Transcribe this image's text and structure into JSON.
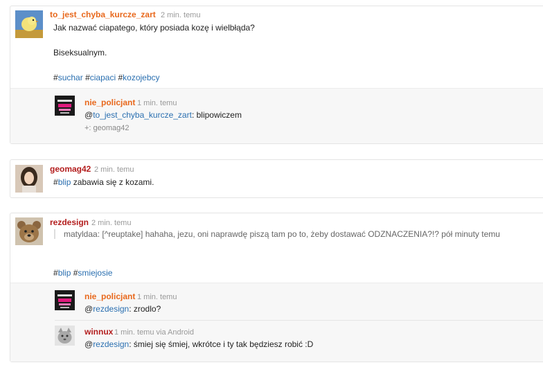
{
  "entries": [
    {
      "author": "to_jest_chyba_kurcze_zart",
      "time": "2 min. temu",
      "lines": [
        "Jak nazwać ciapatego, który posiada kozę i wielbłąda?",
        "Biseksualnym."
      ],
      "tags": [
        "suchar",
        "ciapaci",
        "kozojebcy"
      ],
      "comments": [
        {
          "author": "nie_policjant",
          "time": "1 min. temu",
          "mention": "to_jest_chyba_kurcze_zart",
          "text": ": blipowiczem",
          "plus": "+: geomag42"
        }
      ]
    },
    {
      "author": "geomag42",
      "time": "2 min. temu",
      "tag": "blip",
      "text": " zabawia się z kozami."
    },
    {
      "author": "rezdesign",
      "time": "2 min. temu",
      "quote": "matyldaa: [^reuptake] hahaha, jezu, oni naprawdę piszą tam po to, żeby dostawać ODZNACZENIA?!? pół minuty temu",
      "tags": [
        "blip",
        "smiejosie"
      ],
      "comments": [
        {
          "author": "nie_policjant",
          "time": "1 min. temu",
          "mention": "rezdesign",
          "text": ": zrodlo?"
        },
        {
          "author": "winnux",
          "time": "1 min. temu via Android",
          "mention": "rezdesign",
          "text": ": śmiej się śmiej, wkrótce i ty tak będziesz robić :D"
        }
      ]
    }
  ],
  "colors": {
    "author_orange": "#e8681c",
    "author_red": "#b31d1d",
    "link": "#2a6fb0",
    "meta": "#999999"
  }
}
